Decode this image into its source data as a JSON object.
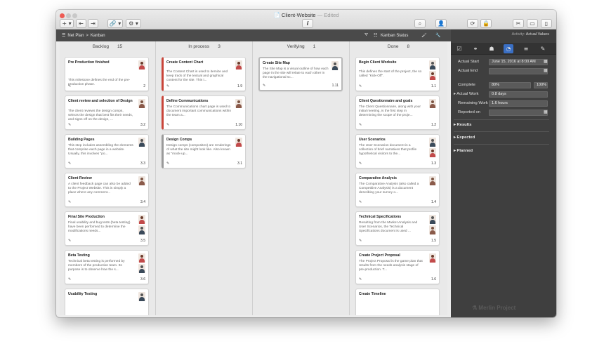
{
  "window": {
    "title": "Client-Website",
    "edited": "— Edited"
  },
  "toolbar": {
    "add": "+ ▾",
    "attach": "🔗 ▾",
    "gear": "⚙ ▾",
    "info": "i",
    "icons": [
      "binoculars-icon",
      "person-icon",
      "refresh-icon",
      "lock-icon",
      "tools-icon",
      "layout-icon",
      "split-icon"
    ]
  },
  "pathbar": {
    "root": "Net Plan",
    "separator": ">",
    "current": "Kanban",
    "filter_label": "Kanban Status"
  },
  "columns": [
    {
      "name": "Backlog",
      "count": "15"
    },
    {
      "name": "In process",
      "count": "3"
    },
    {
      "name": "Verifying",
      "count": "1"
    },
    {
      "name": "Done",
      "count": "8"
    }
  ],
  "cards": {
    "backlog": [
      {
        "title": "Pre Production finished",
        "desc": "This milestone defines the end of the pre-production phase.",
        "num": "2"
      },
      {
        "title": "Client review and selection of Design",
        "desc": "The client reviews the design comps, selects the design that best fits their needs, and signs off on the design, ...",
        "num": "3.2"
      },
      {
        "title": "Building Pages",
        "desc": "This step includes assembling the elements that comprise each page in a website. Usually, this involves \"po...",
        "num": "3.3"
      },
      {
        "title": "Client Review",
        "desc": "A client feedback page can also be added to the Project Website. This is simply a place where any comment...",
        "num": "3.4"
      },
      {
        "title": "Final Site Production",
        "desc": "Final usability and bug tests (beta testing) have been performed to determine the modifications needs...",
        "num": "3.5"
      },
      {
        "title": "Beta Testing",
        "desc": "Technical beta testing is performed by members of the production team. Its purpose is to observe how the s...",
        "num": "3.6"
      },
      {
        "title": "Usability Testing",
        "desc": "",
        "num": ""
      }
    ],
    "inprocess": [
      {
        "title": "Create Content Chart",
        "desc": "The Content Chart is used to itemize and keep track of the textual and graphical content for the site. This i...",
        "num": "1.9"
      },
      {
        "title": "Define Communications",
        "desc": "The Communications chart page is used to document important communications within the team a...",
        "num": "1.10"
      },
      {
        "title": "Design Comps",
        "desc": "Design comps (composites) are renderings of what the site might look like. Also known as \"mock-up...",
        "num": "3.1"
      }
    ],
    "verifying": [
      {
        "title": "Create Site Map",
        "desc": "The Site Map is a visual outline of how each page in the site will relate to each other in the navigational sc...",
        "num": "1.11"
      }
    ],
    "done": [
      {
        "title": "Begin Client Worksite",
        "desc": "This defines the start of the project, the so called \"Kick-Off\".",
        "num": "1.1"
      },
      {
        "title": "Client Questionnaire and goals",
        "desc": "The Client Questionnaire, along with your initial meeting, is the first step in determining the scope of the proje...",
        "num": "1.2"
      },
      {
        "title": "User Scenarios",
        "desc": "The User Scenarios document is a collection of brief narratives that profile hypothetical visitors to the...",
        "num": "1.3"
      },
      {
        "title": "Comparative Analysis",
        "desc": "The Comparative Analysis (also called a Competitive Analysis) is a document describing your survey o...",
        "num": "1.4"
      },
      {
        "title": "Technical Specifications",
        "desc": "Resulting from the Market Analysis and User Scenarios, the Technical Specifications document is used ...",
        "num": "1.5"
      },
      {
        "title": "Create Project Proposal",
        "desc": "The Project Proposal is the game plan that results from the needs analysis stage of pre-production. T...",
        "num": "1.6"
      },
      {
        "title": "Create Timeline",
        "desc": "",
        "num": ""
      }
    ]
  },
  "inspector": {
    "activity_label": "Activity:",
    "activity_value": "Actual Values",
    "actual_start_label": "Actual Start",
    "actual_start_value": "June 15, 2016 at 8:00 AM",
    "actual_end_label": "Actual End",
    "actual_end_value": "",
    "complete_label": "Complete",
    "complete_value": "80%",
    "complete_full": "100%",
    "actual_work_label": "Actual Work",
    "actual_work_value": "0.8 days",
    "remaining_work_label": "Remaining Work",
    "remaining_work_value": "1.6 hours",
    "reported_on_label": "Reported on",
    "reported_on_value": "",
    "sections": [
      "Results",
      "Expected",
      "Planned"
    ],
    "logo": "Merlin Project"
  }
}
